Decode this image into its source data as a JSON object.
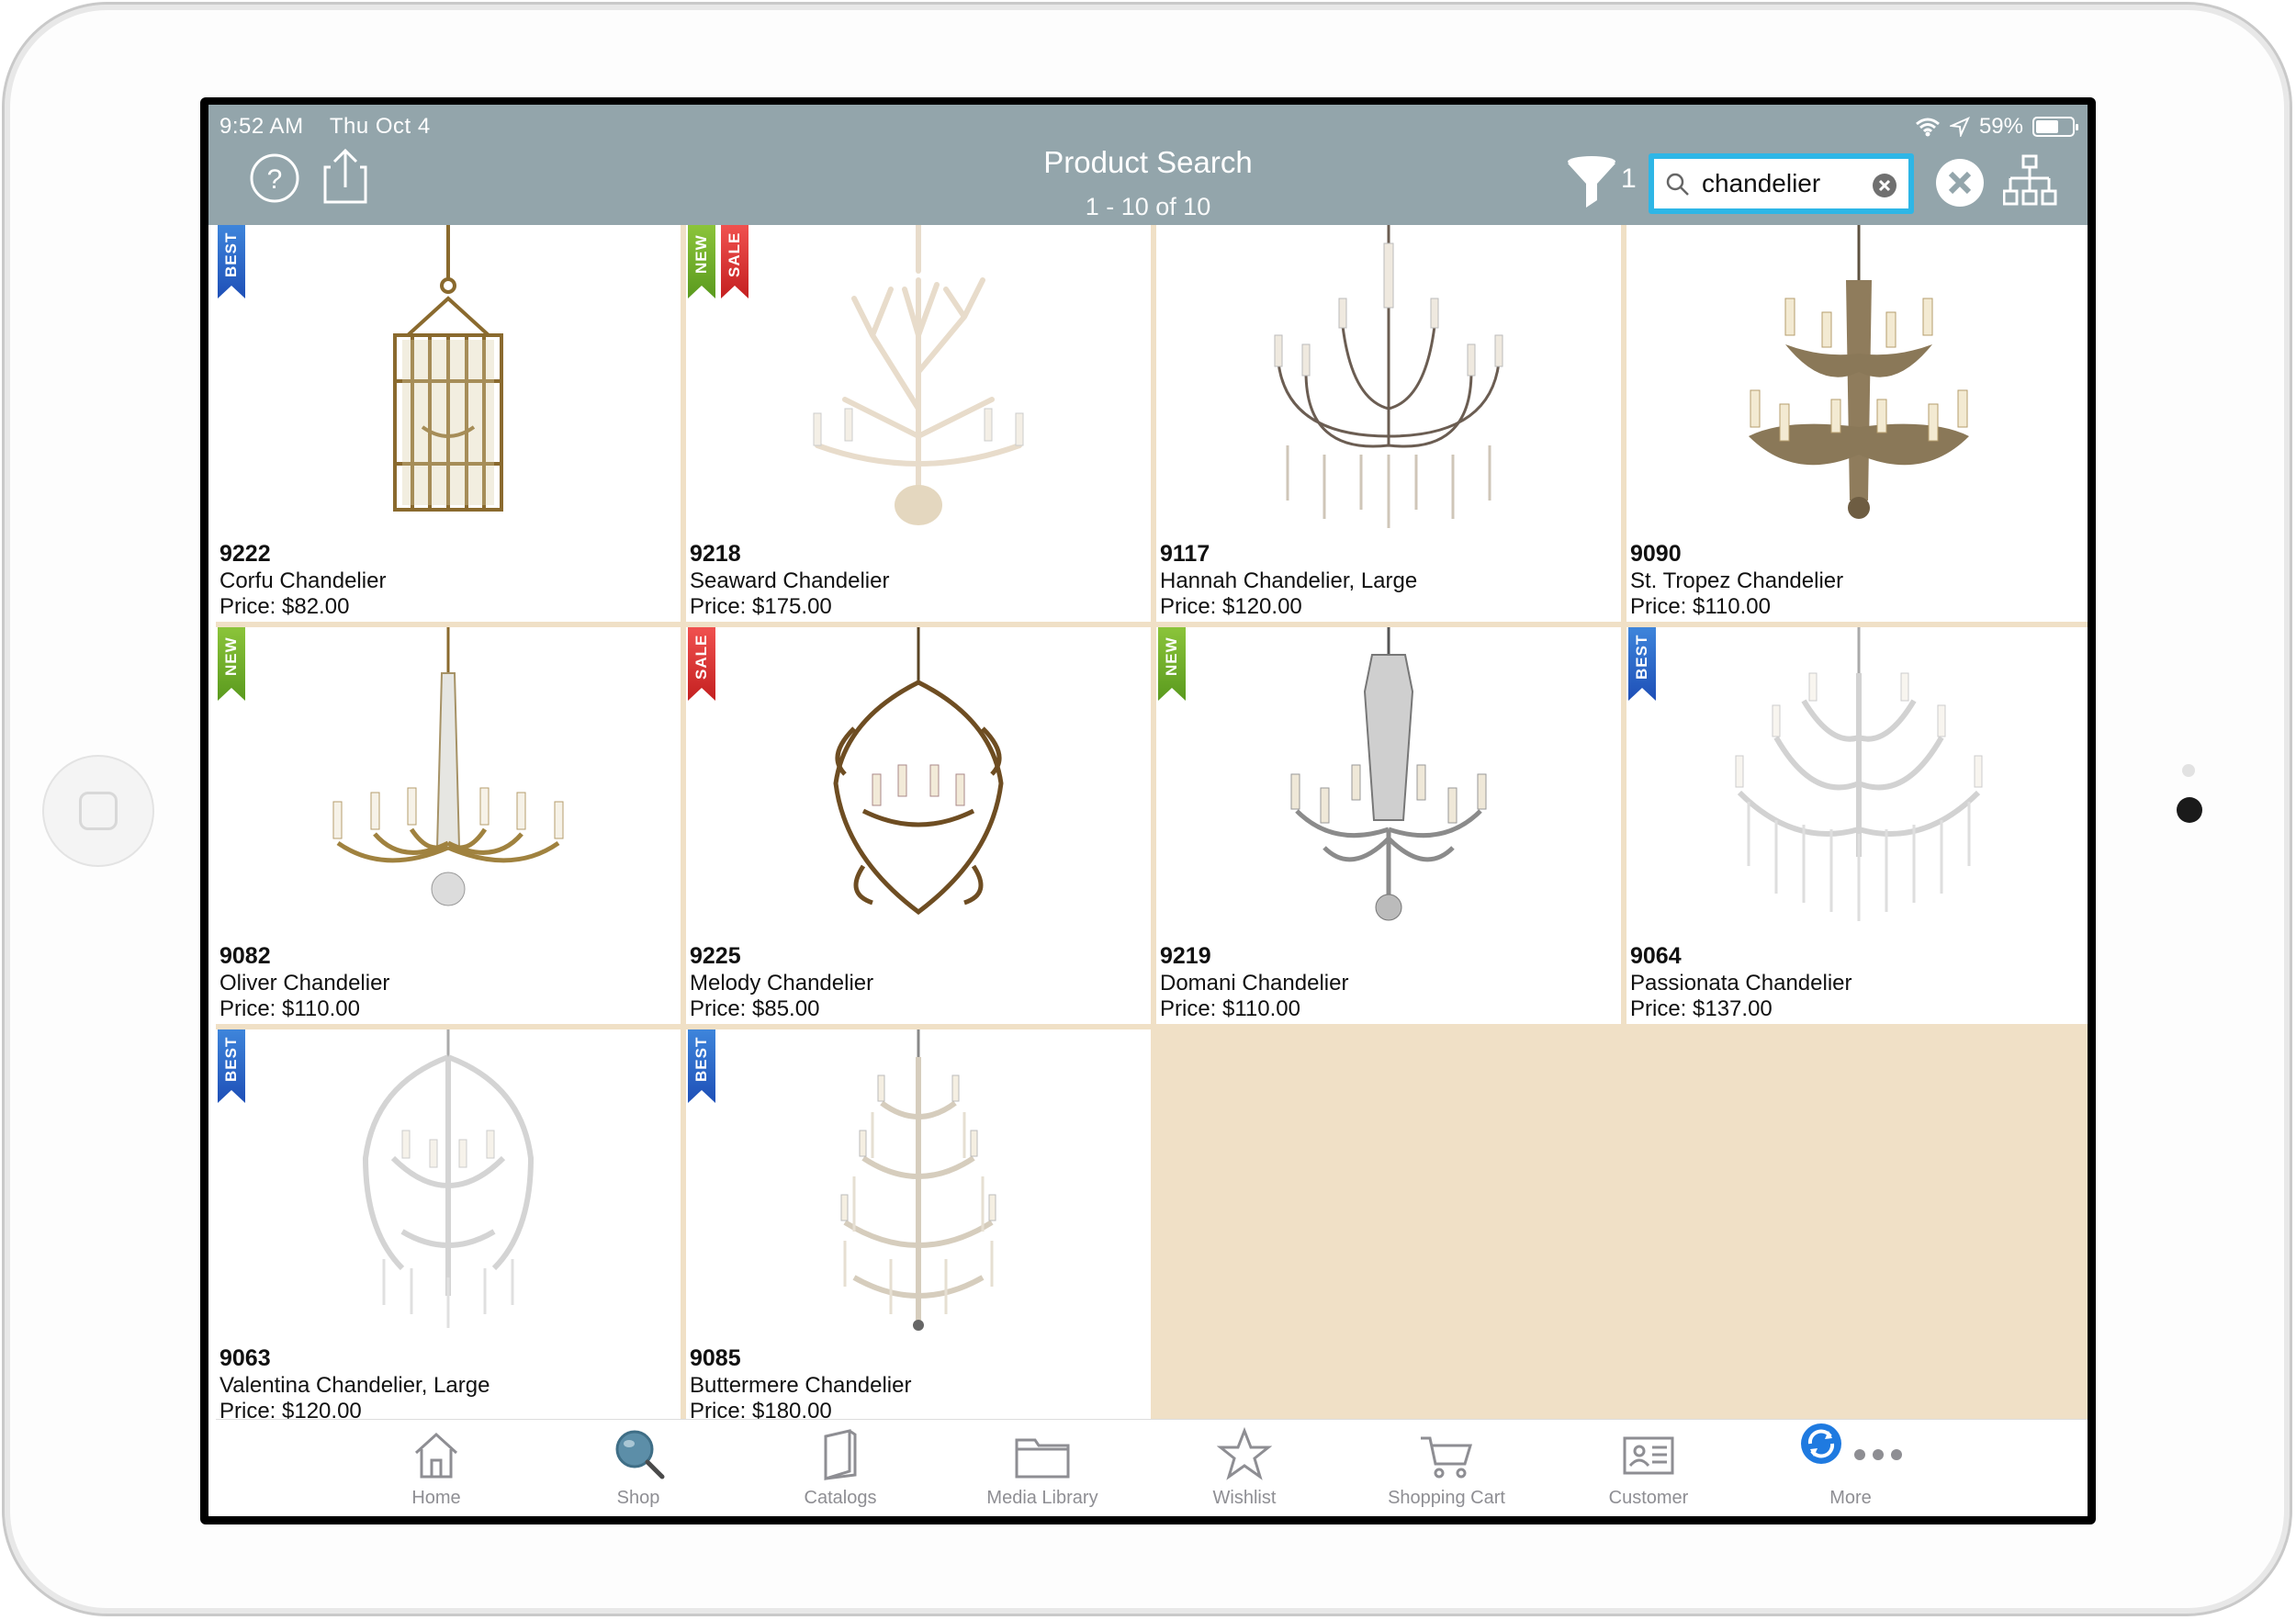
{
  "status": {
    "time": "9:52 AM",
    "date": "Thu Oct 4",
    "battery": "59%"
  },
  "nav": {
    "title": "Product Search",
    "subtitle": "1 - 10 of 10",
    "filter_count": "1"
  },
  "search": {
    "value": "chandelier"
  },
  "products": [
    {
      "number": "9222",
      "name": "Corfu Chandelier",
      "price": "Price: $82.00",
      "badges": [
        "BEST"
      ]
    },
    {
      "number": "9218",
      "name": "Seaward Chandelier",
      "price": "Price: $175.00",
      "badges": [
        "NEW",
        "SALE"
      ]
    },
    {
      "number": "9117",
      "name": "Hannah Chandelier, Large",
      "price": "Price: $120.00",
      "badges": []
    },
    {
      "number": "9090",
      "name": "St. Tropez Chandelier",
      "price": "Price: $110.00",
      "badges": []
    },
    {
      "number": "9082",
      "name": "Oliver Chandelier",
      "price": "Price: $110.00",
      "badges": [
        "NEW"
      ]
    },
    {
      "number": "9225",
      "name": "Melody Chandelier",
      "price": "Price: $85.00",
      "badges": [
        "SALE"
      ]
    },
    {
      "number": "9219",
      "name": "Domani Chandelier",
      "price": "Price: $110.00",
      "badges": [
        "NEW"
      ]
    },
    {
      "number": "9064",
      "name": "Passionata Chandelier",
      "price": "Price: $137.00",
      "badges": [
        "BEST"
      ]
    },
    {
      "number": "9063",
      "name": "Valentina Chandelier, Large",
      "price": "Price: $120.00",
      "badges": [
        "BEST"
      ]
    },
    {
      "number": "9085",
      "name": "Buttermere Chandelier",
      "price": "Price: $180.00",
      "badges": [
        "BEST"
      ]
    }
  ],
  "tabs": [
    {
      "label": "Home",
      "icon": "home-icon"
    },
    {
      "label": "Shop",
      "icon": "magnifier-icon"
    },
    {
      "label": "Catalogs",
      "icon": "book-icon"
    },
    {
      "label": "Media Library",
      "icon": "folder-icon"
    },
    {
      "label": "Wishlist",
      "icon": "star-icon"
    },
    {
      "label": "Shopping Cart",
      "icon": "cart-icon"
    },
    {
      "label": "Customer",
      "icon": "id-card-icon"
    },
    {
      "label": "More",
      "icon": "more-dots-icon"
    }
  ],
  "colors": {
    "navbar": "#93a5ab",
    "search_border": "#2eb6e6",
    "grid_background": "#f0e0c6",
    "badge_best": "#2a62c7",
    "badge_new": "#72ae2a",
    "badge_sale": "#e03a3a",
    "shop_tab": "#5c8ea8",
    "sync": "#1f7ae0"
  }
}
